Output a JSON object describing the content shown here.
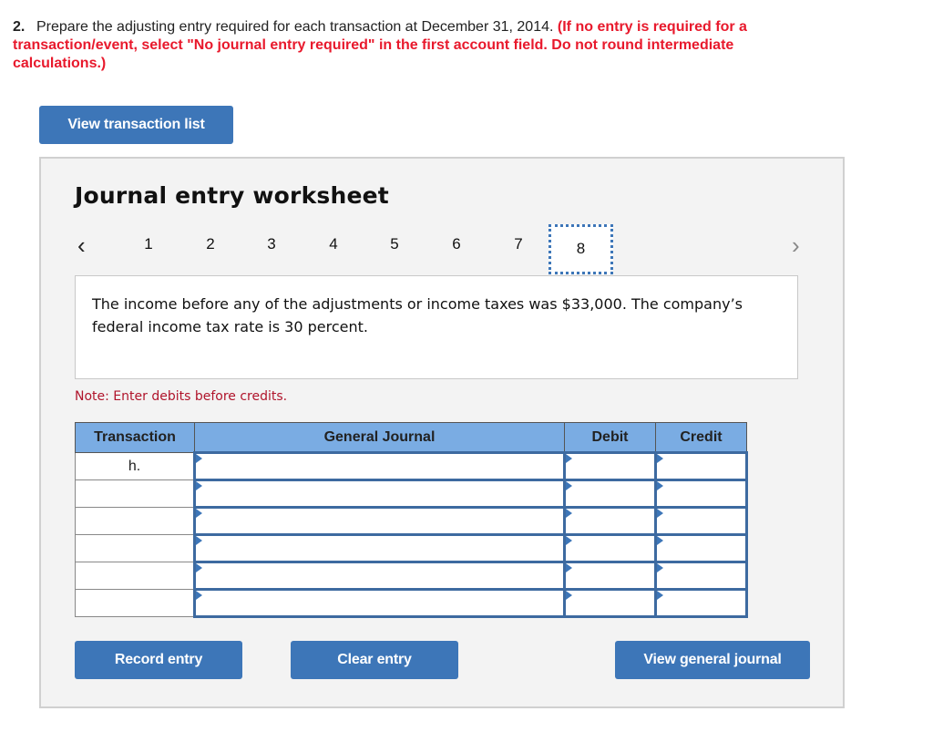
{
  "question": {
    "number": "2.",
    "text": "Prepare the adjusting entry required for each transaction at December 31, 2014.",
    "instruction": "(If no entry is required for a transaction/event, select \"No journal entry required\" in the first account field. Do not round intermediate calculations.)"
  },
  "buttons": {
    "view_transaction_list": "View transaction list",
    "record_entry": "Record entry",
    "clear_entry": "Clear entry",
    "view_general_journal": "View general journal"
  },
  "worksheet": {
    "title": "Journal entry worksheet",
    "pager": {
      "prev_icon": "‹",
      "next_icon": "›",
      "pages": [
        "1",
        "2",
        "3",
        "4",
        "5",
        "6",
        "7",
        "8"
      ],
      "active_page": "8"
    },
    "description": "The income before any of the adjustments or income taxes was $33,000. The company’s federal income tax rate is 30 percent.",
    "note": "Note: Enter debits before credits.",
    "table": {
      "headers": [
        "Transaction",
        "General Journal",
        "Debit",
        "Credit"
      ],
      "rows": [
        {
          "transaction": "h.",
          "account": "",
          "debit": "",
          "credit": ""
        },
        {
          "transaction": "",
          "account": "",
          "debit": "",
          "credit": ""
        },
        {
          "transaction": "",
          "account": "",
          "debit": "",
          "credit": ""
        },
        {
          "transaction": "",
          "account": "",
          "debit": "",
          "credit": ""
        },
        {
          "transaction": "",
          "account": "",
          "debit": "",
          "credit": ""
        },
        {
          "transaction": "",
          "account": "",
          "debit": "",
          "credit": ""
        }
      ]
    }
  },
  "colors": {
    "accent_blue": "#3d76b8",
    "header_blue": "#7aace3",
    "instruction_red": "#e8192c",
    "note_red": "#b0142b"
  }
}
